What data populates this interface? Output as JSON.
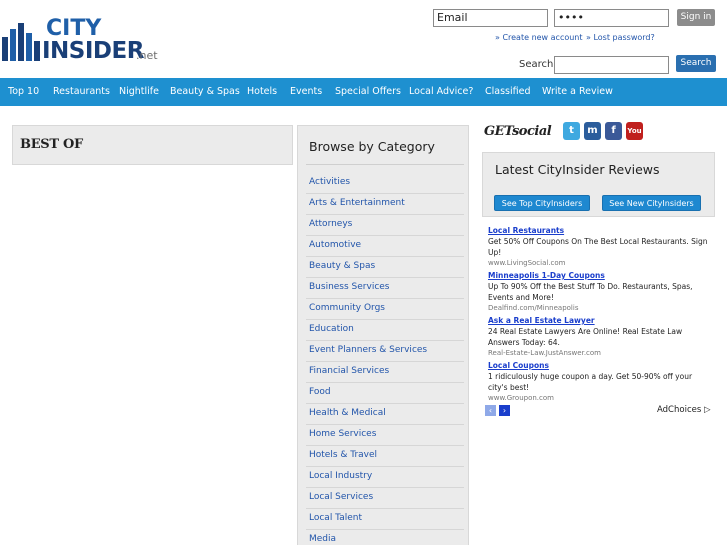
{
  "header": {
    "logo": {
      "line1": "CITY",
      "line2": "INSIDER",
      "suffix": ".net"
    },
    "login": {
      "email_value": "Email",
      "password_value": "••••",
      "signin_label": "Sign in",
      "create_account_label": "» Create new account",
      "lost_password_label": "» Lost password?"
    },
    "search": {
      "label": "Search",
      "value": "",
      "button_label": "Search"
    }
  },
  "nav": {
    "items": [
      {
        "label": "Top 10"
      },
      {
        "label": "Restaurants"
      },
      {
        "label": "Nightlife"
      },
      {
        "label": "Beauty & Spas"
      },
      {
        "label": "Hotels"
      },
      {
        "label": "Events"
      },
      {
        "label": "Special Offers"
      },
      {
        "label": "Local Advice?"
      },
      {
        "label": "Classified"
      },
      {
        "label": "Write a Review"
      }
    ]
  },
  "best_of": {
    "title": "BEST OF"
  },
  "browse": {
    "title": "Browse by Category",
    "categories": [
      "Activities",
      "Arts & Entertainment",
      "Attorneys",
      "Automotive",
      "Beauty & Spas",
      "Business Services",
      "Community Orgs",
      "Education",
      "Event Planners & Services",
      "Financial Services",
      "Food",
      "Health & Medical",
      "Home Services",
      "Hotels & Travel",
      "Local Industry",
      "Local Services",
      "Local Talent",
      "Media"
    ]
  },
  "social": {
    "label": "GETsocial",
    "icons": [
      "twitter-icon",
      "myspace-icon",
      "facebook-icon",
      "youtube-icon"
    ]
  },
  "reviews": {
    "title": "Latest CityInsider Reviews",
    "top_button": "See Top CityInsiders",
    "new_button": "See New CityInsiders"
  },
  "ads": {
    "items": [
      {
        "title": "Local Restaurants",
        "body": "Get 50% Off Coupons On The Best Local Restaurants. Sign Up!",
        "url": "www.LivingSocial.com"
      },
      {
        "title": "Minneapolis 1-Day Coupons",
        "body": "Up To 90% Off the Best Stuff To Do. Restaurants, Spas, Events and More!",
        "url": "Dealfind.com/Minneapolis"
      },
      {
        "title": "Ask a Real Estate Lawyer",
        "body": "24 Real Estate Lawyers Are Online! Real Estate Law Answers Today: 64.",
        "url": "Real-Estate-Law.JustAnswer.com"
      },
      {
        "title": "Local Coupons",
        "body": "1 ridiculously huge coupon a day. Get 50-90% off your city's best!",
        "url": "www.Groupon.com"
      }
    ],
    "adchoices_label": "AdChoices",
    "prev_label": "‹",
    "next_label": "›"
  },
  "colors": {
    "nav_bg": "#1e90d0",
    "brand_blue": "#1f5fa8",
    "link": "#2255aa",
    "ad_title": "#1a3ecc"
  }
}
